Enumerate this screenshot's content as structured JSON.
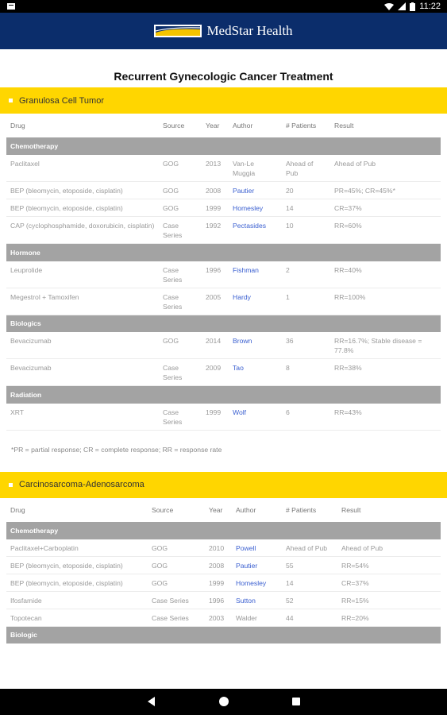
{
  "status_bar": {
    "time": "11:22"
  },
  "app_bar": {
    "brand": "MedStar Health"
  },
  "page": {
    "title": "Recurrent Gynecologic Cancer Treatment"
  },
  "sections": [
    {
      "title": "Granulosa Cell Tumor",
      "headers": [
        "Drug",
        "Source",
        "Year",
        "Author",
        "# Patients",
        "Result"
      ],
      "groups": [
        {
          "category": "Chemotherapy",
          "rows": [
            {
              "drug": "Paclitaxel",
              "source": "GOG",
              "year": "2013",
              "author": "Van-Le Muggia",
              "linked": false,
              "patients": "Ahead of Pub",
              "result": "Ahead of Pub"
            },
            {
              "drug": "BEP (bleomycin, etoposide, cisplatin)",
              "source": "GOG",
              "year": "2008",
              "author": "Pautier",
              "linked": true,
              "patients": "20",
              "result": "PR=45%; CR=45%*"
            },
            {
              "drug": "BEP (bleomycin, etoposide, cisplatin)",
              "source": "GOG",
              "year": "1999",
              "author": "Homesley",
              "linked": true,
              "patients": "14",
              "result": "CR=37%"
            },
            {
              "drug": "CAP (cyclophosphamide, doxorubicin, cisplatin)",
              "source": "Case Series",
              "year": "1992",
              "author": "Pectasides",
              "linked": true,
              "patients": "10",
              "result": "RR=60%"
            }
          ]
        },
        {
          "category": "Hormone",
          "rows": [
            {
              "drug": "Leuprolide",
              "source": "Case Series",
              "year": "1996",
              "author": "Fishman",
              "linked": true,
              "patients": "2",
              "result": "RR=40%"
            },
            {
              "drug": "Megestrol + Tamoxifen",
              "source": "Case Series",
              "year": "2005",
              "author": "Hardy",
              "linked": true,
              "patients": "1",
              "result": "RR=100%"
            }
          ]
        },
        {
          "category": "Biologics",
          "rows": [
            {
              "drug": "Bevacizumab",
              "source": "GOG",
              "year": "2014",
              "author": "Brown",
              "linked": true,
              "patients": "36",
              "result": "RR=16.7%; Stable disease = 77.8%"
            },
            {
              "drug": "Bevacizumab",
              "source": "Case Series",
              "year": "2009",
              "author": "Tao",
              "linked": true,
              "patients": "8",
              "result": "RR=38%"
            }
          ]
        },
        {
          "category": "Radiation",
          "rows": [
            {
              "drug": "XRT",
              "source": "Case Series",
              "year": "1999",
              "author": "Wolf",
              "linked": true,
              "patients": "6",
              "result": "RR=43%"
            }
          ]
        }
      ],
      "footnote": "*PR = partial response; CR = complete response; RR = response rate"
    },
    {
      "title": "Carcinosarcoma-Adenosarcoma",
      "headers": [
        "Drug",
        "Source",
        "Year",
        "Author",
        "# Patients",
        "Result"
      ],
      "groups": [
        {
          "category": "Chemotherapy",
          "rows": [
            {
              "drug": "Paclitaxel+Carboplatin",
              "source": "GOG",
              "year": "2010",
              "author": "Powell",
              "linked": true,
              "patients": "Ahead of Pub",
              "result": "Ahead of Pub"
            },
            {
              "drug": "BEP (bleomycin, etoposide, cisplatin)",
              "source": "GOG",
              "year": "2008",
              "author": "Pautier",
              "linked": true,
              "patients": "55",
              "result": "RR=54%"
            },
            {
              "drug": "BEP (bleomycin, etoposide, cisplatin)",
              "source": "GOG",
              "year": "1999",
              "author": "Homesley",
              "linked": true,
              "patients": "14",
              "result": "CR=37%"
            },
            {
              "drug": "Ifosfamide",
              "source": "Case Series",
              "year": "1996",
              "author": "Sutton",
              "linked": true,
              "patients": "52",
              "result": "RR=15%"
            },
            {
              "drug": "Topotecan",
              "source": "Case Series",
              "year": "2003",
              "author": "Walder",
              "linked": false,
              "patients": "44",
              "result": "RR=20%"
            }
          ]
        },
        {
          "category": "Biologic",
          "rows": []
        }
      ],
      "footnote": ""
    }
  ],
  "colors": {
    "app_bar": "#0b2d6b",
    "section_header": "#ffd600",
    "category_row": "#a3a3a3",
    "link": "#3a5fd0"
  },
  "icons": [
    "notification-icon",
    "wifi-icon",
    "signal-icon",
    "battery-icon",
    "back-icon",
    "home-icon",
    "recents-icon",
    "medstar-logo"
  ]
}
